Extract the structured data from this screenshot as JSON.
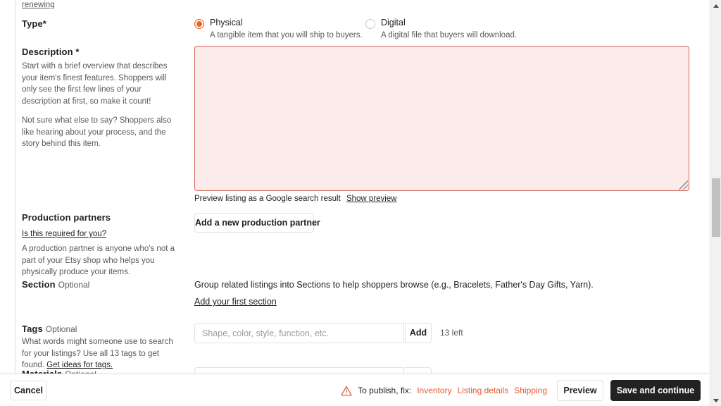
{
  "top_partial_link": "renewing",
  "type_row": {
    "label": "Type*",
    "options": [
      {
        "id": "physical",
        "title": "Physical",
        "description": "A tangible item that you will ship to buyers.",
        "selected": true
      },
      {
        "id": "digital",
        "title": "Digital",
        "description": "A digital file that buyers will download.",
        "selected": false
      }
    ]
  },
  "description_row": {
    "label": "Description *",
    "help_1": "Start with a brief overview that describes your item's finest features. Shoppers will only see the first few lines of your description at first, so make it count!",
    "help_2": "Not sure what else to say? Shoppers also like hearing about your process, and the story behind this item.",
    "textarea_value": "",
    "error": true,
    "preview_note": "Preview listing as a Google search result",
    "preview_link": "Show preview"
  },
  "production_partners_row": {
    "label": "Production partners",
    "required_link": "Is this required for you?",
    "help": "A production partner is anyone who's not a part of your Etsy shop who helps you physically produce your items.",
    "add_button": "Add a new production partner"
  },
  "section_row": {
    "label": "Section",
    "optional": "Optional",
    "description": "Group related listings into Sections to help shoppers browse (e.g., Bracelets, Father's Day Gifts, Yarn).",
    "add_link": "Add your first section"
  },
  "tags_row": {
    "label": "Tags",
    "optional": "Optional",
    "help_prefix": "What words might someone use to search for your listings? Use all 13 tags to get found. ",
    "help_link": "Get ideas for tags.",
    "input_placeholder": "Shape, color, style, function, etc.",
    "input_value": "",
    "add_button": "Add",
    "remaining": "13 left"
  },
  "materials_row": {
    "label": "Materials",
    "optional": "Optional"
  },
  "footer": {
    "cancel_label": "Cancel",
    "warning_icon": "warning-triangle-icon",
    "warning_text": "To publish, fix:",
    "fix_links": [
      "Inventory",
      "Listing details",
      "Shipping"
    ],
    "preview_label": "Preview",
    "save_label": "Save and continue"
  },
  "colors": {
    "accent_orange": "#f1641e",
    "error_border": "#d4675b",
    "error_fill": "#fbeceb",
    "fix_link_red": "#e4572e",
    "primary_button_bg": "#222222",
    "border_gray": "#e1e3df"
  },
  "scrollbar": {
    "up_arrow": "scroll-up-arrow-icon",
    "down_arrow": "scroll-down-arrow-icon"
  }
}
